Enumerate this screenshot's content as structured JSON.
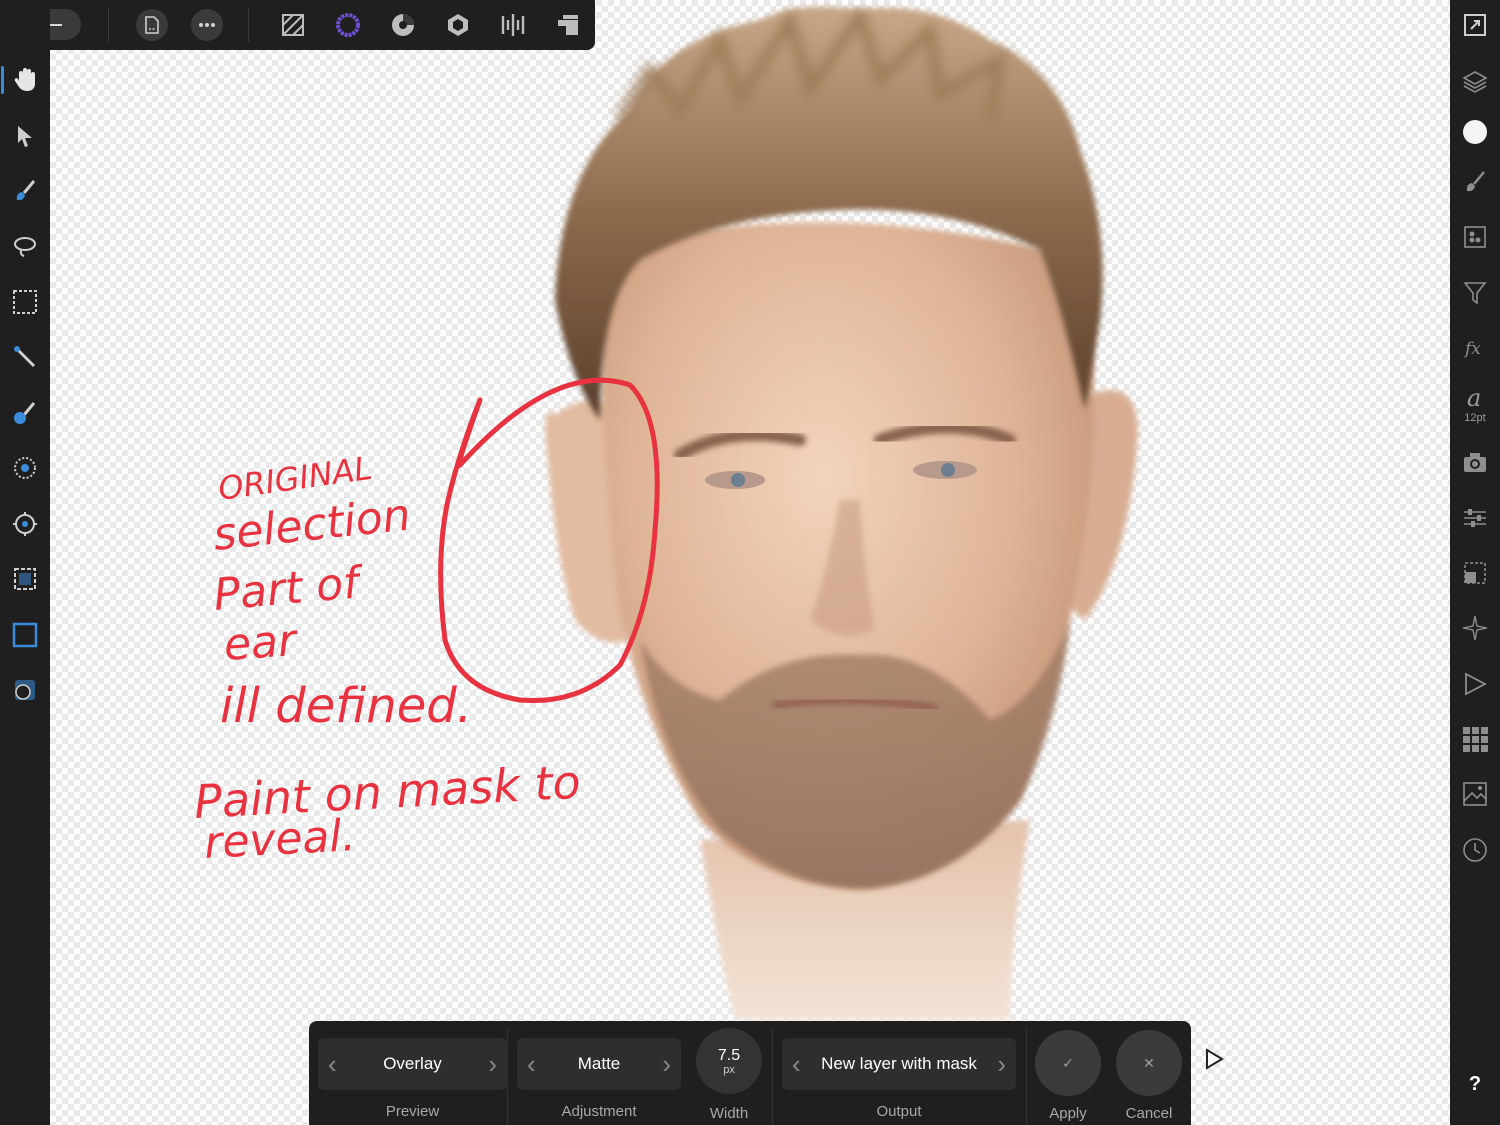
{
  "colors": {
    "chrome": "#1f1f1f",
    "accent_blue": "#3b8bdb",
    "annotation_red": "#e8323f",
    "panel_button": "#3a3a3a"
  },
  "top_bar": {
    "icons": [
      "back-arrow-icon",
      "document-icon",
      "more-icon",
      "photo-persona-icon",
      "liquify-persona-icon",
      "develop-persona-icon",
      "tone-mapping-persona-icon",
      "export-persona-icon",
      "pixel-persona-icon"
    ]
  },
  "left_toolbar": {
    "tools": [
      "hand-tool-icon",
      "move-tool-icon",
      "brush-selection-tool-icon",
      "freehand-selection-tool-icon",
      "rectangular-marquee-tool-icon",
      "magic-wand-tool-icon",
      "selection-brush-icon",
      "blur-brush-icon",
      "crop-ring-icon",
      "dashed-marquee-icon",
      "rectangle-selection-active-icon",
      "quick-mask-icon"
    ],
    "active_tool": "hand-tool-icon"
  },
  "right_bar": {
    "icons": [
      "fullscreen-icon",
      "layers-icon",
      "color-icon",
      "brushes-icon",
      "adjustments-icon",
      "filters-icon",
      "fx-icon",
      "text-style-icon",
      "camera-icon",
      "sliders-icon",
      "transform-icon",
      "navigator-icon",
      "play-icon",
      "grid-icon",
      "image-icon",
      "history-icon"
    ],
    "font_glyph": "a",
    "font_size": "12pt",
    "help": "?"
  },
  "annotation": {
    "lines": [
      "ORIGINAL",
      "selection",
      "Part of",
      "ear",
      "ill defined.",
      "Paint on mask to",
      "reveal."
    ]
  },
  "context_bar": {
    "preview": {
      "value": "Overlay",
      "label": "Preview"
    },
    "adjustment": {
      "value": "Matte",
      "label": "Adjustment"
    },
    "width": {
      "value": "7.5",
      "unit": "px",
      "label": "Width"
    },
    "output": {
      "value": "New layer with mask",
      "label": "Output"
    },
    "apply": {
      "glyph": "✓",
      "label": "Apply"
    },
    "cancel": {
      "glyph": "✕",
      "label": "Cancel"
    }
  }
}
